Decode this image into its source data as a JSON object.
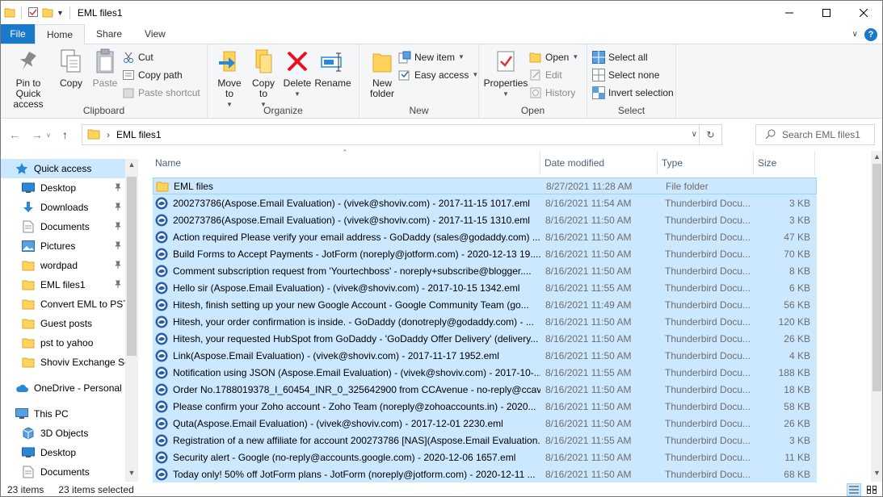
{
  "window": {
    "title": "EML files1",
    "minimize_icon": "minimize-icon",
    "maximize_icon": "maximize-icon",
    "close_icon": "close-icon"
  },
  "quick_access_toolbar": {
    "icons": [
      "folder-icon",
      "properties-icon",
      "new-folder-icon",
      "customize-icon"
    ]
  },
  "ribbon_tabs": [
    "File",
    "Home",
    "Share",
    "View"
  ],
  "active_tab": "Home",
  "ribbon": {
    "clipboard": {
      "label": "Clipboard",
      "pin_label": "Pin to Quick access",
      "copy_label": "Copy",
      "paste_label": "Paste",
      "cut_label": "Cut",
      "copy_path_label": "Copy path",
      "paste_shortcut_label": "Paste shortcut"
    },
    "organize": {
      "label": "Organize",
      "move_to_label": "Move to",
      "copy_to_label": "Copy to",
      "delete_label": "Delete",
      "rename_label": "Rename"
    },
    "new": {
      "label": "New",
      "new_folder_label": "New folder",
      "new_item_label": "New item",
      "easy_access_label": "Easy access"
    },
    "open": {
      "label": "Open",
      "properties_label": "Properties",
      "open_label": "Open",
      "edit_label": "Edit",
      "history_label": "History"
    },
    "select": {
      "label": "Select",
      "select_all_label": "Select all",
      "select_none_label": "Select none",
      "invert_selection_label": "Invert selection"
    }
  },
  "address": {
    "path": "EML files1",
    "search_placeholder": "Search EML files1"
  },
  "nav_pane": {
    "items": [
      {
        "label": "Quick access",
        "icon": "star-icon",
        "indent": 1,
        "pinned": false,
        "selected": true
      },
      {
        "label": "Desktop",
        "icon": "desktop-icon",
        "indent": 2,
        "pinned": true
      },
      {
        "label": "Downloads",
        "icon": "download-icon",
        "indent": 2,
        "pinned": true
      },
      {
        "label": "Documents",
        "icon": "documents-icon",
        "indent": 2,
        "pinned": true
      },
      {
        "label": "Pictures",
        "icon": "pictures-icon",
        "indent": 2,
        "pinned": true
      },
      {
        "label": "wordpad",
        "icon": "folder-icon",
        "indent": 2,
        "pinned": true
      },
      {
        "label": "EML files1",
        "icon": "folder-icon",
        "indent": 2,
        "pinned": true
      },
      {
        "label": "Convert EML to PST",
        "icon": "folder-icon",
        "indent": 2,
        "pinned": false
      },
      {
        "label": "Guest posts",
        "icon": "folder-icon",
        "indent": 2,
        "pinned": false
      },
      {
        "label": "pst to yahoo",
        "icon": "folder-icon",
        "indent": 2,
        "pinned": false
      },
      {
        "label": "Shoviv Exchange Ser",
        "icon": "folder-icon",
        "indent": 2,
        "pinned": false
      },
      {
        "label": "",
        "spacer": true
      },
      {
        "label": "OneDrive - Personal",
        "icon": "cloud-icon",
        "indent": 1,
        "pinned": false
      },
      {
        "label": "",
        "spacer": true
      },
      {
        "label": "This PC",
        "icon": "computer-icon",
        "indent": 1,
        "pinned": false
      },
      {
        "label": "3D Objects",
        "icon": "cube-icon",
        "indent": 2,
        "pinned": false
      },
      {
        "label": "Desktop",
        "icon": "desktop-icon",
        "indent": 2,
        "pinned": false
      },
      {
        "label": "Documents",
        "icon": "documents-icon",
        "indent": 2,
        "pinned": false
      }
    ]
  },
  "columns": [
    "Name",
    "Date modified",
    "Type",
    "Size"
  ],
  "files": [
    {
      "name": "EML files",
      "date": "8/27/2021 11:28 AM",
      "type": "File folder",
      "size": "",
      "icon": "folder-icon"
    },
    {
      "name": "200273786(Aspose.Email Evaluation) - (vivek@shoviv.com) - 2017-11-15 1017.eml",
      "date": "8/16/2021 11:54 AM",
      "type": "Thunderbird Docu...",
      "size": "3 KB",
      "icon": "thunderbird-icon"
    },
    {
      "name": "200273786(Aspose.Email Evaluation) - (vivek@shoviv.com) - 2017-11-15 1310.eml",
      "date": "8/16/2021 11:50 AM",
      "type": "Thunderbird Docu...",
      "size": "3 KB",
      "icon": "thunderbird-icon"
    },
    {
      "name": "Action required  Please verify your email address - GoDaddy (sales@godaddy.com) ...",
      "date": "8/16/2021 11:50 AM",
      "type": "Thunderbird Docu...",
      "size": "47 KB",
      "icon": "thunderbird-icon"
    },
    {
      "name": "Build Forms to Accept Payments - JotForm (noreply@jotform.com) - 2020-12-13 19....",
      "date": "8/16/2021 11:50 AM",
      "type": "Thunderbird Docu...",
      "size": "70 KB",
      "icon": "thunderbird-icon"
    },
    {
      "name": "Comment subscription request from 'Yourtechboss' - noreply+subscribe@blogger....",
      "date": "8/16/2021 11:50 AM",
      "type": "Thunderbird Docu...",
      "size": "8 KB",
      "icon": "thunderbird-icon"
    },
    {
      "name": "Hello sir (Aspose.Email Evaluation) - (vivek@shoviv.com) - 2017-10-15 1342.eml",
      "date": "8/16/2021 11:55 AM",
      "type": "Thunderbird Docu...",
      "size": "6 KB",
      "icon": "thunderbird-icon"
    },
    {
      "name": "Hitesh, finish setting up your new Google Account - Google Community Team (go...",
      "date": "8/16/2021 11:49 AM",
      "type": "Thunderbird Docu...",
      "size": "56 KB",
      "icon": "thunderbird-icon"
    },
    {
      "name": "Hitesh, your order confirmation is inside. - GoDaddy (donotreply@godaddy.com) - ...",
      "date": "8/16/2021 11:50 AM",
      "type": "Thunderbird Docu...",
      "size": "120 KB",
      "icon": "thunderbird-icon"
    },
    {
      "name": "Hitesh, your requested HubSpot from GoDaddy - 'GoDaddy Offer Delivery' (delivery...",
      "date": "8/16/2021 11:50 AM",
      "type": "Thunderbird Docu...",
      "size": "26 KB",
      "icon": "thunderbird-icon"
    },
    {
      "name": "Link(Aspose.Email Evaluation) - (vivek@shoviv.com) - 2017-11-17 1952.eml",
      "date": "8/16/2021 11:50 AM",
      "type": "Thunderbird Docu...",
      "size": "4 KB",
      "icon": "thunderbird-icon"
    },
    {
      "name": "Notification using JSON (Aspose.Email Evaluation) - (vivek@shoviv.com) - 2017-10-...",
      "date": "8/16/2021 11:55 AM",
      "type": "Thunderbird Docu...",
      "size": "188 KB",
      "icon": "thunderbird-icon"
    },
    {
      "name": "Order No.1788019378_I_60454_INR_0_325642900 from CCAvenue - no-reply@ccave...",
      "date": "8/16/2021 11:50 AM",
      "type": "Thunderbird Docu...",
      "size": "18 KB",
      "icon": "thunderbird-icon"
    },
    {
      "name": "Please confirm your Zoho account - Zoho Team (noreply@zohoaccounts.in) - 2020...",
      "date": "8/16/2021 11:50 AM",
      "type": "Thunderbird Docu...",
      "size": "58 KB",
      "icon": "thunderbird-icon"
    },
    {
      "name": "Quta(Aspose.Email Evaluation) - (vivek@shoviv.com) - 2017-12-01 2230.eml",
      "date": "8/16/2021 11:50 AM",
      "type": "Thunderbird Docu...",
      "size": "26 KB",
      "icon": "thunderbird-icon"
    },
    {
      "name": "Registration of a new affiliate for account 200273786 [NAS](Aspose.Email Evaluation...",
      "date": "8/16/2021 11:55 AM",
      "type": "Thunderbird Docu...",
      "size": "3 KB",
      "icon": "thunderbird-icon"
    },
    {
      "name": "Security alert - Google (no-reply@accounts.google.com) - 2020-12-06 1657.eml",
      "date": "8/16/2021 11:50 AM",
      "type": "Thunderbird Docu...",
      "size": "11 KB",
      "icon": "thunderbird-icon"
    },
    {
      "name": "Today only! 50% off JotForm plans - JotForm (noreply@jotform.com) - 2020-12-11 ...",
      "date": "8/16/2021 11:50 AM",
      "type": "Thunderbird Docu...",
      "size": "68 KB",
      "icon": "thunderbird-icon"
    }
  ],
  "status": {
    "item_count": "23 items",
    "selected_count": "23 items selected"
  },
  "colors": {
    "accent": "#1979ca",
    "selection": "#cce8ff",
    "selection_border": "#99d1ff",
    "delete_red": "#e81123",
    "folder_yellow": "#ffd35c"
  }
}
